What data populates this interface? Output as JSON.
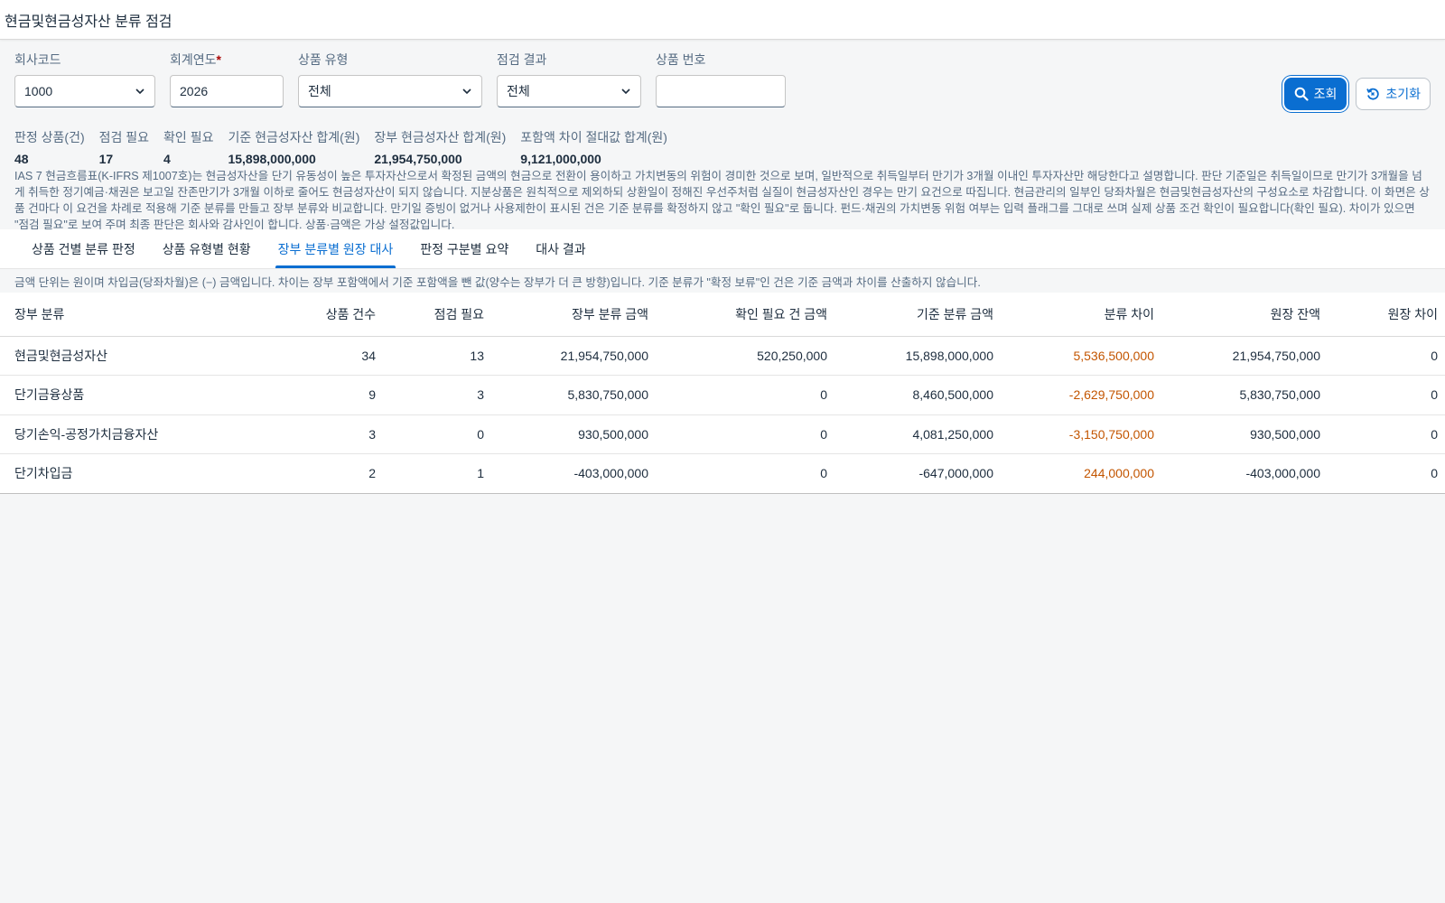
{
  "header": {
    "title": "현금및현금성자산 분류 점검"
  },
  "filters": {
    "company_code": {
      "label": "회사코드",
      "value": "1000"
    },
    "fiscal_year": {
      "label": "회계연도",
      "required": "*",
      "value": "2026"
    },
    "product_type": {
      "label": "상품 유형",
      "value": "전체"
    },
    "check_result": {
      "label": "점검 결과",
      "value": "전체"
    },
    "product_no": {
      "label": "상품 번호",
      "value": ""
    }
  },
  "buttons": {
    "search": "조회",
    "reset": "초기화"
  },
  "kpis": [
    {
      "label": "판정 상품(건)",
      "value": "48"
    },
    {
      "label": "점검 필요",
      "value": "17"
    },
    {
      "label": "확인 필요",
      "value": "4"
    },
    {
      "label": "기준 현금성자산 합계(원)",
      "value": "15,898,000,000"
    },
    {
      "label": "장부 현금성자산 합계(원)",
      "value": "21,954,750,000"
    },
    {
      "label": "포함액 차이 절대값 합계(원)",
      "value": "9,121,000,000"
    }
  ],
  "note": "IAS 7 현금흐름표(K-IFRS 제1007호)는 현금성자산을 단기 유동성이 높은 투자자산으로서 확정된 금액의 현금으로 전환이 용이하고 가치변동의 위험이 경미한 것으로 보며, 일반적으로 취득일부터 만기가 3개월 이내인 투자자산만 해당한다고 설명합니다. 판단 기준일은 취득일이므로 만기가 3개월을 넘게 취득한 정기예금·채권은 보고일 잔존만기가 3개월 이하로 줄어도 현금성자산이 되지 않습니다. 지분상품은 원칙적으로 제외하되 상환일이 정해진 우선주처럼 실질이 현금성자산인 경우는 만기 요건으로 따집니다. 현금관리의 일부인 당좌차월은 현금및현금성자산의 구성요소로 차감합니다. 이 화면은 상품 건마다 이 요건을 차례로 적용해 기준 분류를 만들고 장부 분류와 비교합니다. 만기일 증빙이 없거나 사용제한이 표시된 건은 기준 분류를 확정하지 않고 \"확인 필요\"로 둡니다. 펀드·채권의 가치변동 위험 여부는 입력 플래그를 그대로 쓰며 실제 상품 조건 확인이 필요합니다(확인 필요). 차이가 있으면 \"점검 필요\"로 보여 주며 최종 판단은 회사와 감사인이 합니다. 상품·금액은 가상 설정값입니다.",
  "tabs": [
    {
      "label": "상품 건별 분류 판정"
    },
    {
      "label": "상품 유형별 현황"
    },
    {
      "label": "장부 분류별 원장 대사"
    },
    {
      "label": "판정 구분별 요약"
    },
    {
      "label": "대사 결과"
    }
  ],
  "tab_note": "금액 단위는 원이며 차입금(당좌차월)은 (−) 금액입니다. 차이는 장부 포함액에서 기준 포함액을 뺀 값(양수는 장부가 더 큰 방향)입니다. 기준 분류가 \"확정 보류\"인 건은 기준 금액과 차이를 산출하지 않습니다.",
  "table": {
    "columns": [
      "장부 분류",
      "상품 건수",
      "점검 필요",
      "장부 분류 금액",
      "확인 필요 건 금액",
      "기준 분류 금액",
      "분류 차이",
      "원장 잔액",
      "원장 차이"
    ],
    "rows": [
      [
        "현금및현금성자산",
        "34",
        "13",
        "21,954,750,000",
        "520,250,000",
        "15,898,000,000",
        "5,536,500,000",
        "21,954,750,000",
        "0"
      ],
      [
        "단기금융상품",
        "9",
        "3",
        "5,830,750,000",
        "0",
        "8,460,500,000",
        "-2,629,750,000",
        "5,830,750,000",
        "0"
      ],
      [
        "당기손익-공정가치금융자산",
        "3",
        "0",
        "930,500,000",
        "0",
        "4,081,250,000",
        "-3,150,750,000",
        "930,500,000",
        "0"
      ],
      [
        "단기차입금",
        "2",
        "1",
        "-403,000,000",
        "0",
        "-647,000,000",
        "244,000,000",
        "-403,000,000",
        "0"
      ]
    ]
  },
  "colors": {
    "accent": "#0a6ed1",
    "warning": "#c35500"
  }
}
